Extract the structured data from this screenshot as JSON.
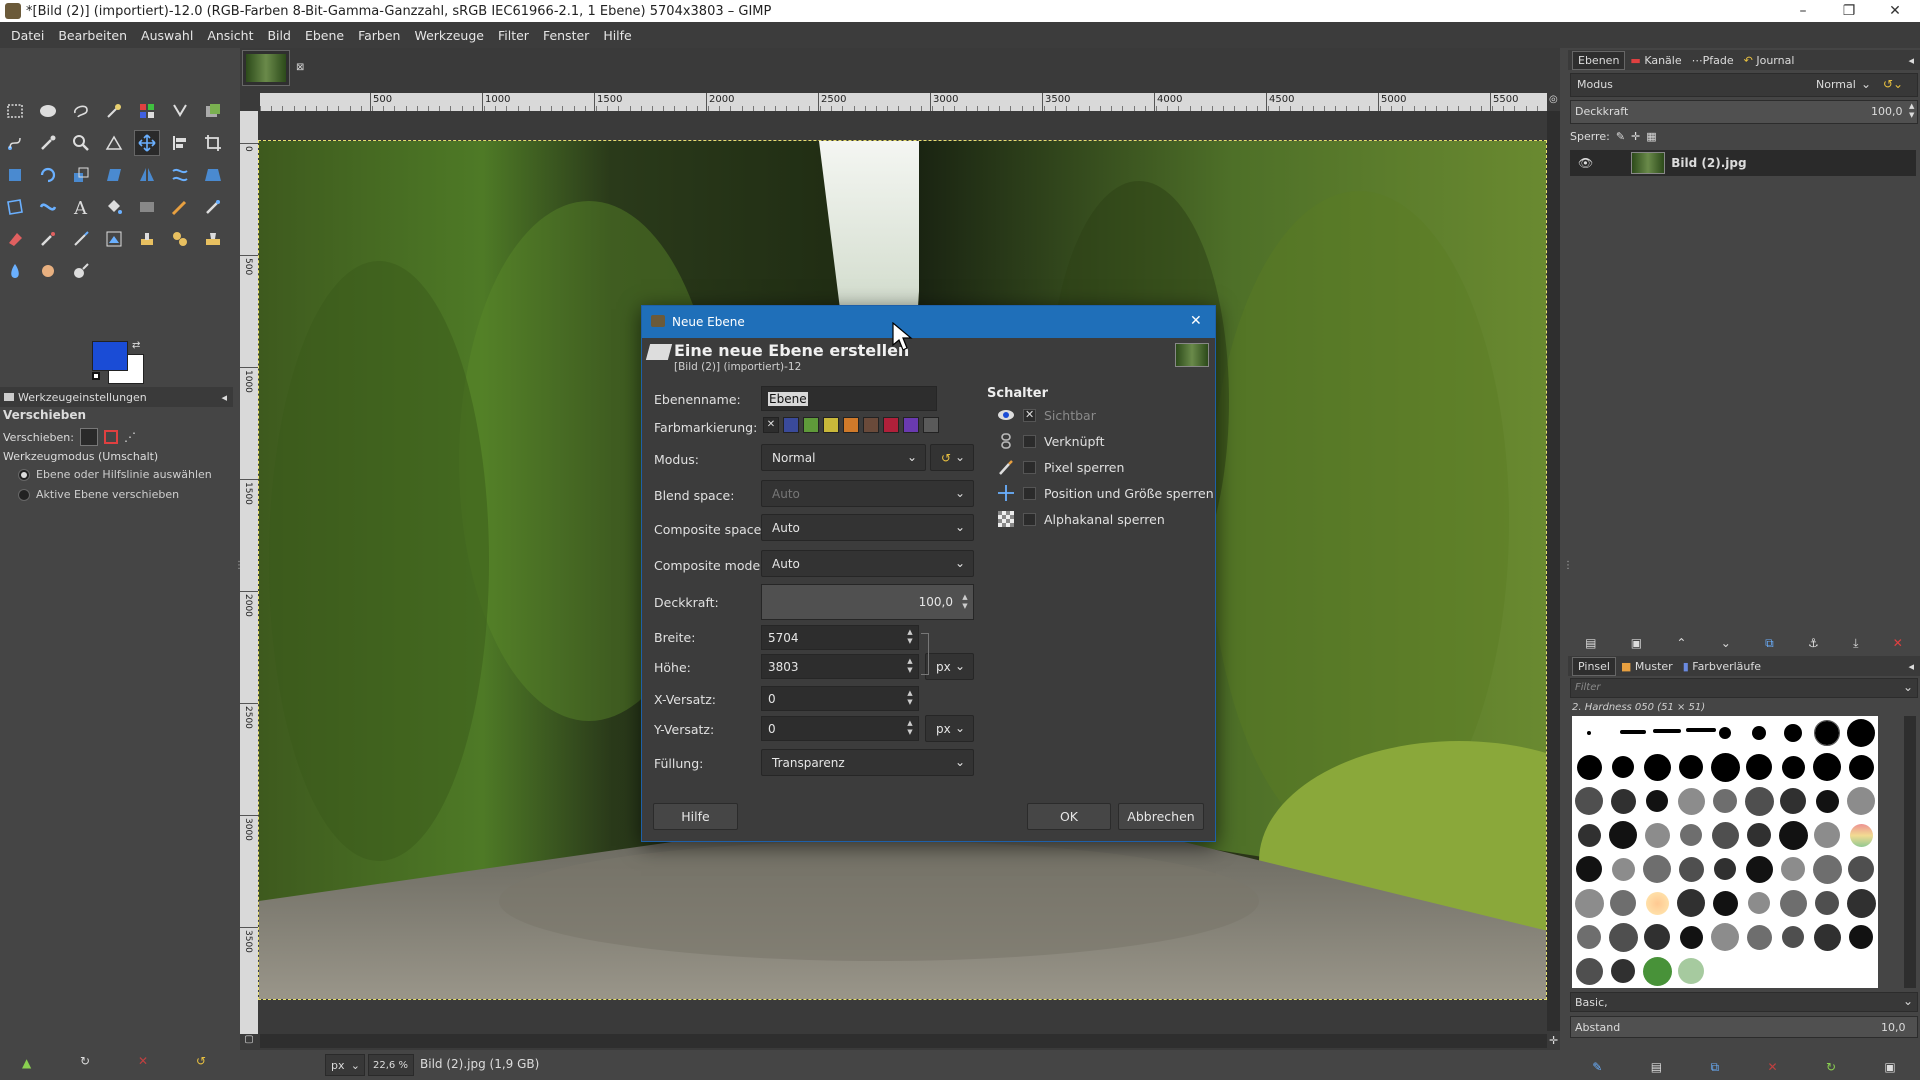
{
  "window": {
    "title": "*[Bild (2)] (importiert)-12.0 (RGB-Farben 8-Bit-Gamma-Ganzzahl, sRGB IEC61966-2.1, 1 Ebene) 5704x3803 – GIMP",
    "minimize": "–",
    "maximize": "❐",
    "close": "✕"
  },
  "menu": [
    "Datei",
    "Bearbeiten",
    "Auswahl",
    "Ansicht",
    "Bild",
    "Ebene",
    "Farben",
    "Werkzeuge",
    "Filter",
    "Fenster",
    "Hilfe"
  ],
  "toolbox": {
    "colors": {
      "foreground": "#1a4cd6",
      "background": "#ffffff"
    },
    "tool_options_tab": "Werkzeugeinstellungen",
    "tool_name": "Verschieben",
    "move_label": "Verschieben:",
    "mode_label": "Werkzeugmodus (Umschalt)",
    "radio_options": [
      "Ebene oder Hilfslinie auswählen",
      "Aktive Ebene verschieben"
    ]
  },
  "ruler": {
    "h_ticks": [
      "500",
      "1000",
      "1500",
      "2000",
      "2500",
      "3000",
      "3500",
      "4000",
      "4500",
      "5000",
      "5500"
    ],
    "v_ticks": [
      "0",
      "500",
      "1000",
      "1500",
      "2000",
      "2500",
      "3000",
      "3500"
    ]
  },
  "statusbar": {
    "unit": "px",
    "zoom": "22,6 %",
    "info": "Bild (2).jpg (1,9 GB)"
  },
  "layers_panel": {
    "tabs": [
      "Ebenen",
      "Kanäle",
      "Pfade",
      "Journal"
    ],
    "mode_label": "Modus",
    "mode_value": "Normal",
    "opacity_label": "Deckkraft",
    "opacity_value": "100,0",
    "lock_label": "Sperre:",
    "layer_name": "Bild (2).jpg"
  },
  "brushes_panel": {
    "tabs": [
      "Pinsel",
      "Muster",
      "Farbverläufe"
    ],
    "filter_placeholder": "Filter",
    "brush_name": "2. Hardness 050 (51 × 51)",
    "preset": "Basic,",
    "spacing_label": "Abstand",
    "spacing_value": "10,0"
  },
  "dialog": {
    "window_title": "Neue Ebene",
    "header": "Eine neue Ebene erstellen",
    "subheader": "[Bild (2)] (importiert)-12",
    "fields": {
      "name_label": "Ebenenname:",
      "name_value": "Ebene",
      "color_tag_label": "Farbmarkierung:",
      "mode_label": "Modus:",
      "mode_value": "Normal",
      "blend_space_label": "Blend space:",
      "blend_space_value": "Auto",
      "composite_space_label": "Composite space:",
      "composite_space_value": "Auto",
      "composite_mode_label": "Composite mode:",
      "composite_mode_value": "Auto",
      "opacity_label": "Deckkraft:",
      "opacity_value": "100,0",
      "width_label": "Breite:",
      "width_value": "5704",
      "height_label": "Höhe:",
      "height_value": "3803",
      "unit_value": "px",
      "offset_x_label": "X-Versatz:",
      "offset_x_value": "0",
      "offset_y_label": "Y-Versatz:",
      "offset_y_value": "0",
      "fill_label": "Füllung:",
      "fill_value": "Transparenz"
    },
    "color_tags": [
      "#3a4a9a",
      "#5f9a3a",
      "#c9b83a",
      "#d07a2a",
      "#6a4a3a",
      "#b0203a",
      "#6a3ab0",
      "#5a5a5a"
    ],
    "switches_title": "Schalter",
    "switches": [
      {
        "label": "Sichtbar",
        "checked": true
      },
      {
        "label": "Verknüpft",
        "checked": false
      },
      {
        "label": "Pixel sperren",
        "checked": false
      },
      {
        "label": "Position und Größe sperren",
        "checked": false
      },
      {
        "label": "Alphakanal sperren",
        "checked": false
      }
    ],
    "buttons": {
      "help": "Hilfe",
      "ok": "OK",
      "cancel": "Abbrechen"
    }
  }
}
